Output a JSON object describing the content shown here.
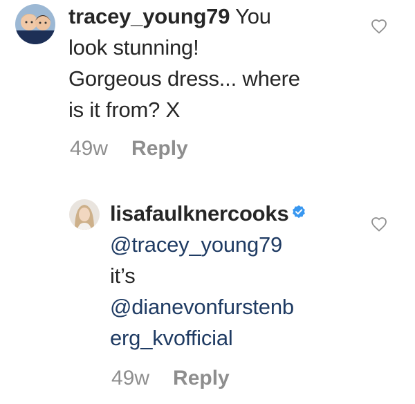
{
  "comments": [
    {
      "username": "tracey_young79",
      "text_line1": "You",
      "text_line2": "look stunning!",
      "text_line3": "Gorgeous dress... where",
      "text_line4": "is it from? X",
      "time": "49w",
      "reply_label": "Reply",
      "avatar_icon": "avatar-two-children-icon",
      "like_icon": "heart-outline-icon"
    },
    {
      "username": "lisafaulknercooks",
      "verified": true,
      "verified_icon": "verified-badge-icon",
      "verified_color": "#3897f0",
      "mention1": "@tracey_young79",
      "text": "it’s",
      "mention2_line1": "@dianevonfurstenb",
      "mention2_line2": "erg_kvofficial",
      "time": "49w",
      "reply_label": "Reply",
      "avatar_icon": "avatar-woman-icon",
      "like_icon": "heart-outline-icon"
    }
  ],
  "colors": {
    "text": "#262626",
    "mention": "#1f3b63",
    "meta": "#8e8e8e",
    "background": "#ffffff"
  }
}
